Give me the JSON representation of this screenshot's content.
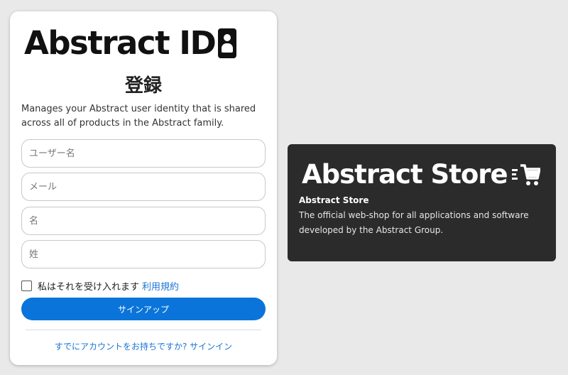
{
  "signup": {
    "brand": "Abstract ID",
    "title": "登録",
    "description": "Manages your Abstract user identity that is shared across all of products in the Abstract family.",
    "fields": {
      "username": {
        "placeholder": "ユーザー名",
        "value": ""
      },
      "email": {
        "placeholder": "メール",
        "value": ""
      },
      "first_name": {
        "placeholder": "名",
        "value": ""
      },
      "last_name": {
        "placeholder": "姓",
        "value": ""
      }
    },
    "consent_label": "私はそれを受け入れます",
    "terms_link": "利用規約",
    "consent_checked": false,
    "signup_button": "サインアップ",
    "signin_link": "すでにアカウントをお持ちですか? サインイン"
  },
  "store": {
    "brand": "Abstract Store",
    "name": "Abstract Store",
    "description": "The official web-shop for all applications and software developed by the Abstract Group."
  },
  "colors": {
    "background": "#e9e9e9",
    "primary": "#0a74da",
    "link": "#1b73d6",
    "store_card": "#2b2b2b"
  },
  "icons": {
    "brand_badge": "id-badge-icon",
    "store_badge": "cart-icon"
  }
}
